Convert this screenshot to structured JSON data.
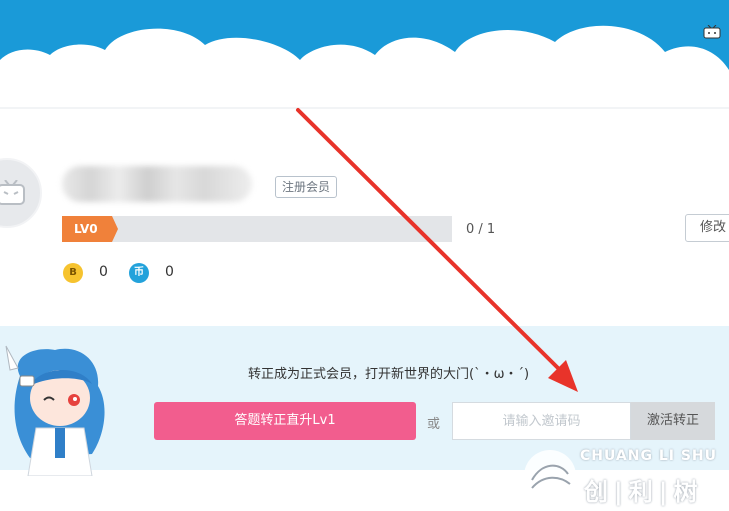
{
  "profile": {
    "register_badge": "注册会员",
    "level_badge": "LV0",
    "level_progress": 0,
    "level_count": "0 / 1",
    "edit_label": "修改",
    "b_coin_icon": "B",
    "b_coin_value": "0",
    "coin_icon": "币",
    "coin_value": "0"
  },
  "promo": {
    "message": "转正成为正式会员，打开新世界的大门(`・ω・´)",
    "answer_button": "答题转正直升Lv1",
    "or_label": "或",
    "invite_placeholder": "请输入邀请码",
    "activate_button": "激活转正"
  },
  "watermark": {
    "en": "CHUANG LI SHU",
    "cn": "创|利|树"
  },
  "colors": {
    "header_blue": "#1296db",
    "level_orange": "#f0813a",
    "primary_pink": "#f25d8e",
    "promo_bg": "#e5f4fb",
    "arrow_red": "#e8332a"
  }
}
